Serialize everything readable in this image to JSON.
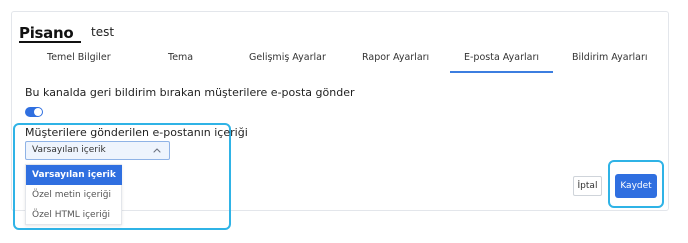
{
  "header": {
    "logo_text": "Pisano",
    "project_name": "test"
  },
  "tabs": [
    {
      "label": "Temel Bilgiler",
      "active": false
    },
    {
      "label": "Tema",
      "active": false
    },
    {
      "label": "Gelişmiş Ayarlar",
      "active": false
    },
    {
      "label": "Rapor Ayarları",
      "active": false
    },
    {
      "label": "E-posta Ayarları",
      "active": true
    },
    {
      "label": "Bildirim Ayarları",
      "active": false
    }
  ],
  "settings": {
    "toggle_label": "Bu kanalda geri bildirim bırakan müşterilere e-posta gönder",
    "toggle_on": true,
    "content_label": "Müşterilere gönderilen e-postanın içeriği",
    "content_select_value": "Varsayılan içerik",
    "content_options": [
      {
        "label": "Varsayılan içerik",
        "selected": true
      },
      {
        "label": "Özel metin içeriği",
        "selected": false
      },
      {
        "label": "Özel HTML içeriği",
        "selected": false
      }
    ]
  },
  "actions": {
    "cancel_label": "İptal",
    "save_label": "Kaydet"
  },
  "colors": {
    "accent": "#2f6fe0",
    "highlight": "#2fb3e6",
    "active_tab_underline": "#3c7ee0"
  }
}
